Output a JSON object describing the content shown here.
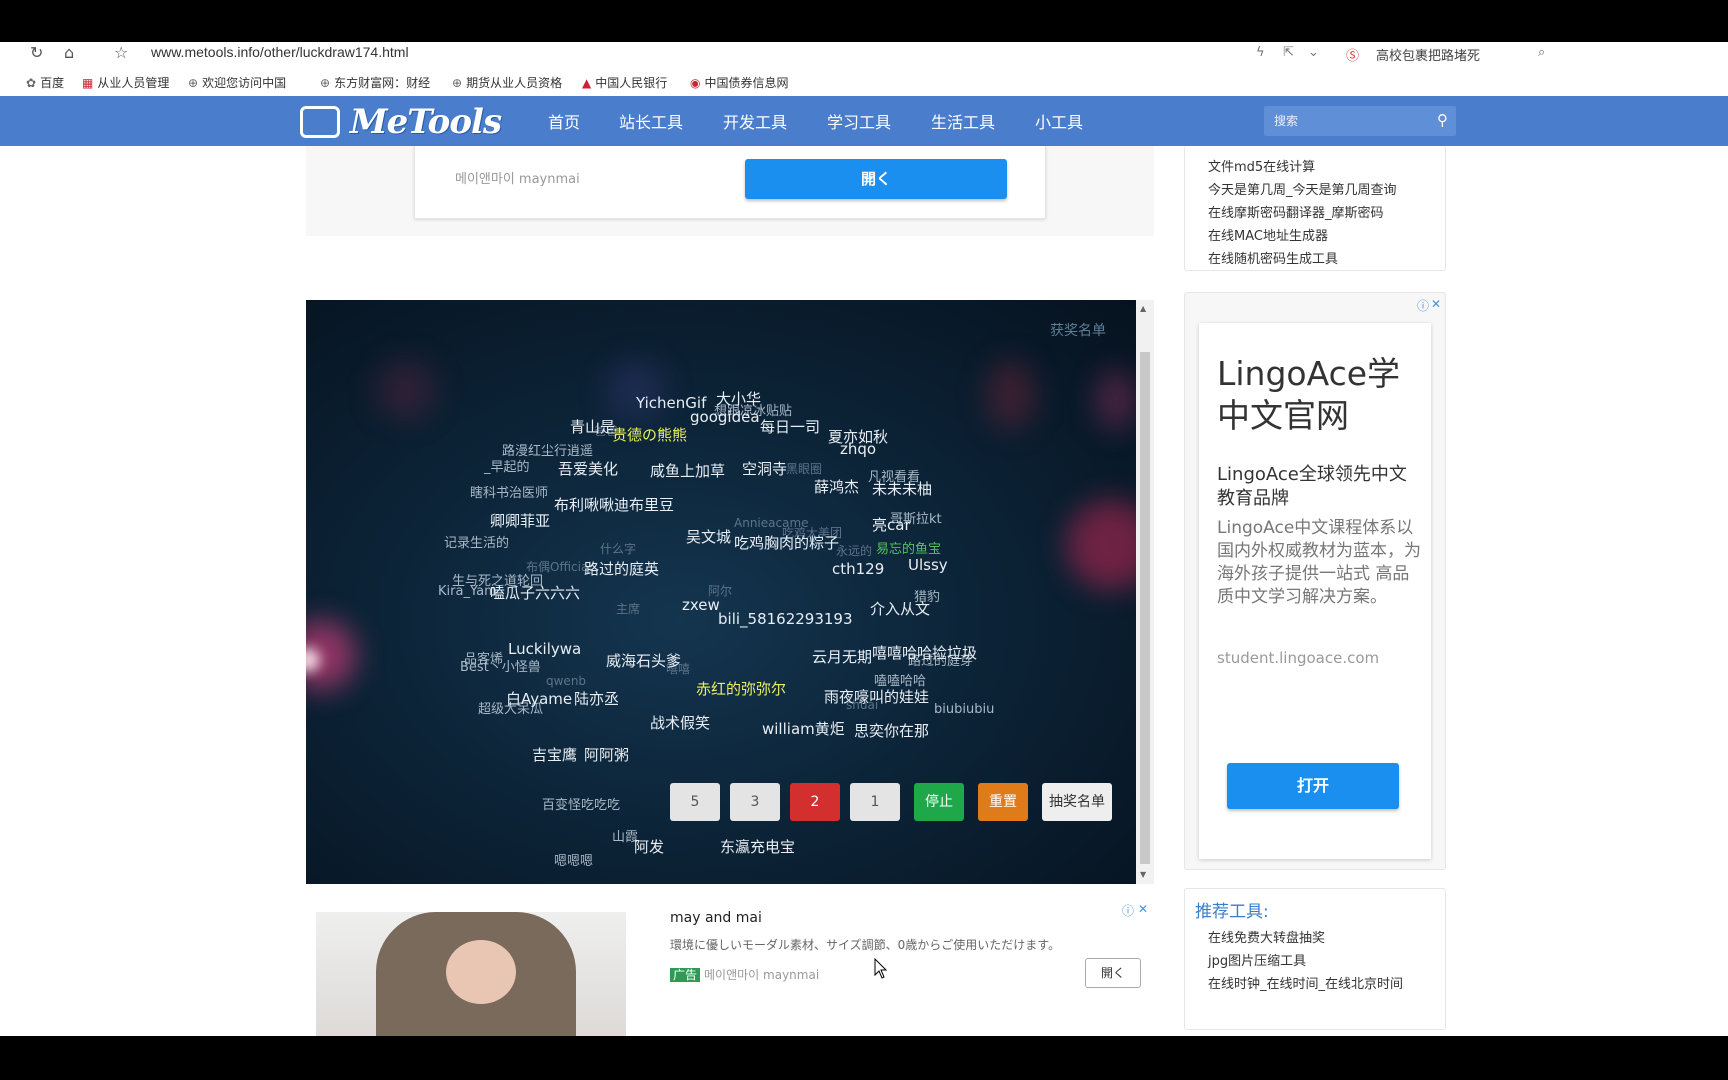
{
  "browser": {
    "url": "www.metools.info/other/luckdraw174.html",
    "search_hint": "高校包裹把路堵死",
    "bookmarks": [
      "百度",
      "从业人员管理",
      "欢迎您访问中国",
      "东方财富网：财经",
      "期货从业人员资格",
      "中国人民银行",
      "中国债券信息网"
    ]
  },
  "header": {
    "logo": "MeTools",
    "nav": [
      "首页",
      "站长工具",
      "开发工具",
      "学习工具",
      "生活工具",
      "小工具"
    ],
    "search_placeholder": "搜索"
  },
  "top_ad": {
    "advertiser": "메이앤마이 maynmai",
    "button": "開く"
  },
  "lottery": {
    "winners_label": "获奖名单",
    "names_bright": [
      "YichenGif",
      "大小华",
      "青山是",
      "googidea",
      "每日一司",
      "夏亦如秋",
      "zhqo",
      "吾爱美化",
      "咸鱼上加草",
      "空洞寺",
      "薛鸿杰",
      "未未未柚",
      "布利啾啾迪布里豆",
      "卿卿菲亚",
      "亮car",
      "吴文城",
      "吃鸡胸肉的粽子",
      "路过的庭英",
      "cth129",
      "Ulssy",
      "Kira_Yam",
      "嗑瓜子六六六",
      "zxew",
      "bili_58162293193",
      "介入从文",
      "Luckilywa",
      "Best丶小怪兽",
      "威海石头爹",
      "云月无期",
      "嘻嘻哈哈捡垃圾",
      "白Ayame",
      "陆亦丞",
      "雨夜嚎叫的娃娃",
      "战术假笑",
      "william黄炬",
      "思奕你在那",
      "吉宝鹰",
      "阿阿粥",
      "阿发",
      "东瀛充电宝"
    ],
    "names_mid": [
      "想跟凉冰贴贴",
      "路漫红尘行逍遥",
      "_早起的",
      "瞎科书治医师",
      "凡视看看",
      "哥斯拉kt",
      "记录生活的",
      "生与死之道轮回",
      "猎豹",
      "路过的庭芽",
      "嗑嗑哈哈",
      "biubiubiu",
      "品客烯",
      "超级大呆瓜",
      "百变怪吃吃吃",
      "山霞",
      "嗯嗯嗯"
    ],
    "names_dim": [
      "爸爸",
      "黑眼圈",
      "什么字",
      "永远的",
      "Annieacame",
      "吃鸡大美团",
      "布偶Official",
      "阿尔",
      "主席",
      "shuai",
      "嘻嘻",
      "qwenb"
    ],
    "highlight_names": [
      "贵德の熊熊",
      "赤红的弥弥尔"
    ],
    "green_name": "易忘的鱼宝",
    "count_buttons": [
      "5",
      "3",
      "2",
      "1"
    ],
    "stop": "停止",
    "reset": "重置",
    "draw_list": "抽奖名单"
  },
  "bottom_ad": {
    "title": "may and mai",
    "desc": "環境に優しいモーダル素材、サイズ調節、0歳からご使用いただけます。",
    "tag": "广告",
    "advertiser": "메이앤마이 maynmai",
    "button": "開く"
  },
  "sidebar": {
    "top_links": [
      "文件md5在线计算",
      "今天是第几周_今天是第几周查询",
      "在线摩斯密码翻译器_摩斯密码",
      "在线MAC地址生成器",
      "在线随机密码生成工具"
    ],
    "ad": {
      "headline": "LingoAce学中文官网",
      "sub": "LingoAce全球领先中文教育品牌",
      "para": "LingoAce中文课程体系以国内外权威教材为蓝本，为海外孩子提供一站式 高品质中文学习解决方案。",
      "url": "student.lingoace.com",
      "button": "打开"
    },
    "recommend_title": "推荐工具:",
    "recommend_links": [
      "在线免费大转盘抽奖",
      "jpg图片压缩工具",
      "在线时钟_在线时间_在线北京时间"
    ]
  }
}
